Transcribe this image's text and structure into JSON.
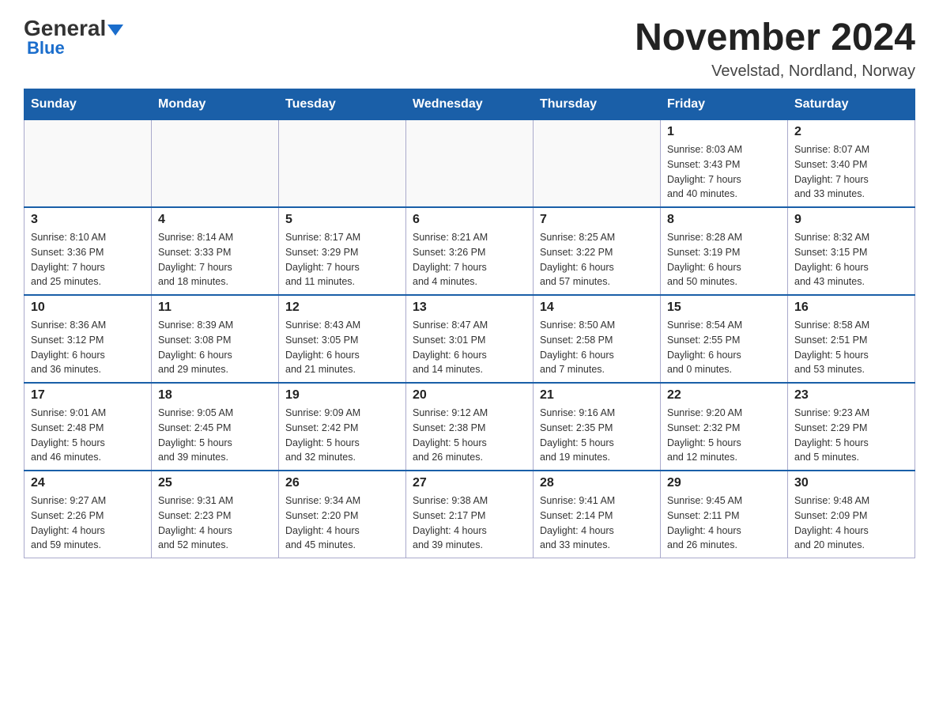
{
  "header": {
    "logo_general": "General",
    "logo_blue": "Blue",
    "main_title": "November 2024",
    "subtitle": "Vevelstad, Nordland, Norway"
  },
  "weekdays": [
    "Sunday",
    "Monday",
    "Tuesday",
    "Wednesday",
    "Thursday",
    "Friday",
    "Saturday"
  ],
  "weeks": [
    [
      {
        "day": "",
        "info": ""
      },
      {
        "day": "",
        "info": ""
      },
      {
        "day": "",
        "info": ""
      },
      {
        "day": "",
        "info": ""
      },
      {
        "day": "",
        "info": ""
      },
      {
        "day": "1",
        "info": "Sunrise: 8:03 AM\nSunset: 3:43 PM\nDaylight: 7 hours\nand 40 minutes."
      },
      {
        "day": "2",
        "info": "Sunrise: 8:07 AM\nSunset: 3:40 PM\nDaylight: 7 hours\nand 33 minutes."
      }
    ],
    [
      {
        "day": "3",
        "info": "Sunrise: 8:10 AM\nSunset: 3:36 PM\nDaylight: 7 hours\nand 25 minutes."
      },
      {
        "day": "4",
        "info": "Sunrise: 8:14 AM\nSunset: 3:33 PM\nDaylight: 7 hours\nand 18 minutes."
      },
      {
        "day": "5",
        "info": "Sunrise: 8:17 AM\nSunset: 3:29 PM\nDaylight: 7 hours\nand 11 minutes."
      },
      {
        "day": "6",
        "info": "Sunrise: 8:21 AM\nSunset: 3:26 PM\nDaylight: 7 hours\nand 4 minutes."
      },
      {
        "day": "7",
        "info": "Sunrise: 8:25 AM\nSunset: 3:22 PM\nDaylight: 6 hours\nand 57 minutes."
      },
      {
        "day": "8",
        "info": "Sunrise: 8:28 AM\nSunset: 3:19 PM\nDaylight: 6 hours\nand 50 minutes."
      },
      {
        "day": "9",
        "info": "Sunrise: 8:32 AM\nSunset: 3:15 PM\nDaylight: 6 hours\nand 43 minutes."
      }
    ],
    [
      {
        "day": "10",
        "info": "Sunrise: 8:36 AM\nSunset: 3:12 PM\nDaylight: 6 hours\nand 36 minutes."
      },
      {
        "day": "11",
        "info": "Sunrise: 8:39 AM\nSunset: 3:08 PM\nDaylight: 6 hours\nand 29 minutes."
      },
      {
        "day": "12",
        "info": "Sunrise: 8:43 AM\nSunset: 3:05 PM\nDaylight: 6 hours\nand 21 minutes."
      },
      {
        "day": "13",
        "info": "Sunrise: 8:47 AM\nSunset: 3:01 PM\nDaylight: 6 hours\nand 14 minutes."
      },
      {
        "day": "14",
        "info": "Sunrise: 8:50 AM\nSunset: 2:58 PM\nDaylight: 6 hours\nand 7 minutes."
      },
      {
        "day": "15",
        "info": "Sunrise: 8:54 AM\nSunset: 2:55 PM\nDaylight: 6 hours\nand 0 minutes."
      },
      {
        "day": "16",
        "info": "Sunrise: 8:58 AM\nSunset: 2:51 PM\nDaylight: 5 hours\nand 53 minutes."
      }
    ],
    [
      {
        "day": "17",
        "info": "Sunrise: 9:01 AM\nSunset: 2:48 PM\nDaylight: 5 hours\nand 46 minutes."
      },
      {
        "day": "18",
        "info": "Sunrise: 9:05 AM\nSunset: 2:45 PM\nDaylight: 5 hours\nand 39 minutes."
      },
      {
        "day": "19",
        "info": "Sunrise: 9:09 AM\nSunset: 2:42 PM\nDaylight: 5 hours\nand 32 minutes."
      },
      {
        "day": "20",
        "info": "Sunrise: 9:12 AM\nSunset: 2:38 PM\nDaylight: 5 hours\nand 26 minutes."
      },
      {
        "day": "21",
        "info": "Sunrise: 9:16 AM\nSunset: 2:35 PM\nDaylight: 5 hours\nand 19 minutes."
      },
      {
        "day": "22",
        "info": "Sunrise: 9:20 AM\nSunset: 2:32 PM\nDaylight: 5 hours\nand 12 minutes."
      },
      {
        "day": "23",
        "info": "Sunrise: 9:23 AM\nSunset: 2:29 PM\nDaylight: 5 hours\nand 5 minutes."
      }
    ],
    [
      {
        "day": "24",
        "info": "Sunrise: 9:27 AM\nSunset: 2:26 PM\nDaylight: 4 hours\nand 59 minutes."
      },
      {
        "day": "25",
        "info": "Sunrise: 9:31 AM\nSunset: 2:23 PM\nDaylight: 4 hours\nand 52 minutes."
      },
      {
        "day": "26",
        "info": "Sunrise: 9:34 AM\nSunset: 2:20 PM\nDaylight: 4 hours\nand 45 minutes."
      },
      {
        "day": "27",
        "info": "Sunrise: 9:38 AM\nSunset: 2:17 PM\nDaylight: 4 hours\nand 39 minutes."
      },
      {
        "day": "28",
        "info": "Sunrise: 9:41 AM\nSunset: 2:14 PM\nDaylight: 4 hours\nand 33 minutes."
      },
      {
        "day": "29",
        "info": "Sunrise: 9:45 AM\nSunset: 2:11 PM\nDaylight: 4 hours\nand 26 minutes."
      },
      {
        "day": "30",
        "info": "Sunrise: 9:48 AM\nSunset: 2:09 PM\nDaylight: 4 hours\nand 20 minutes."
      }
    ]
  ]
}
